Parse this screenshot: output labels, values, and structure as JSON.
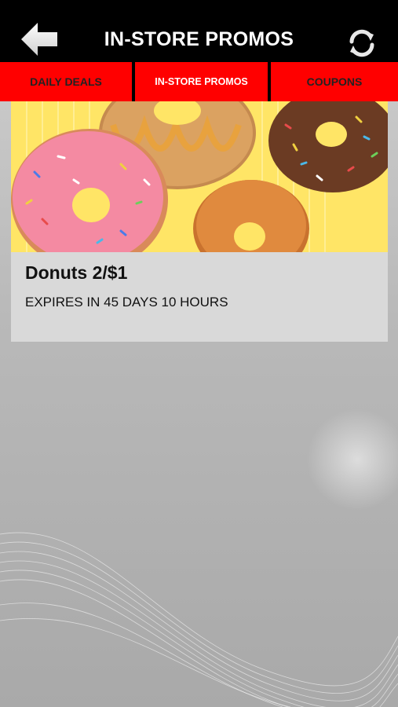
{
  "header": {
    "title": "IN-STORE PROMOS",
    "back_icon": "back-arrow-icon",
    "refresh_icon": "refresh-icon"
  },
  "tabs": [
    {
      "label": "DAILY DEALS",
      "active": false
    },
    {
      "label": "IN-STORE PROMOS",
      "active": true
    },
    {
      "label": "COUPONS",
      "active": false
    }
  ],
  "promos": [
    {
      "title": "Donuts 2/$1",
      "expiry": "EXPIRES IN 45 DAYS 10 HOURS",
      "image": "donuts-photo"
    }
  ],
  "colors": {
    "header_bg": "#000000",
    "tab_bg": "#ff0000",
    "card_bg": "#d9d9d9",
    "image_bg": "#ffe566"
  }
}
